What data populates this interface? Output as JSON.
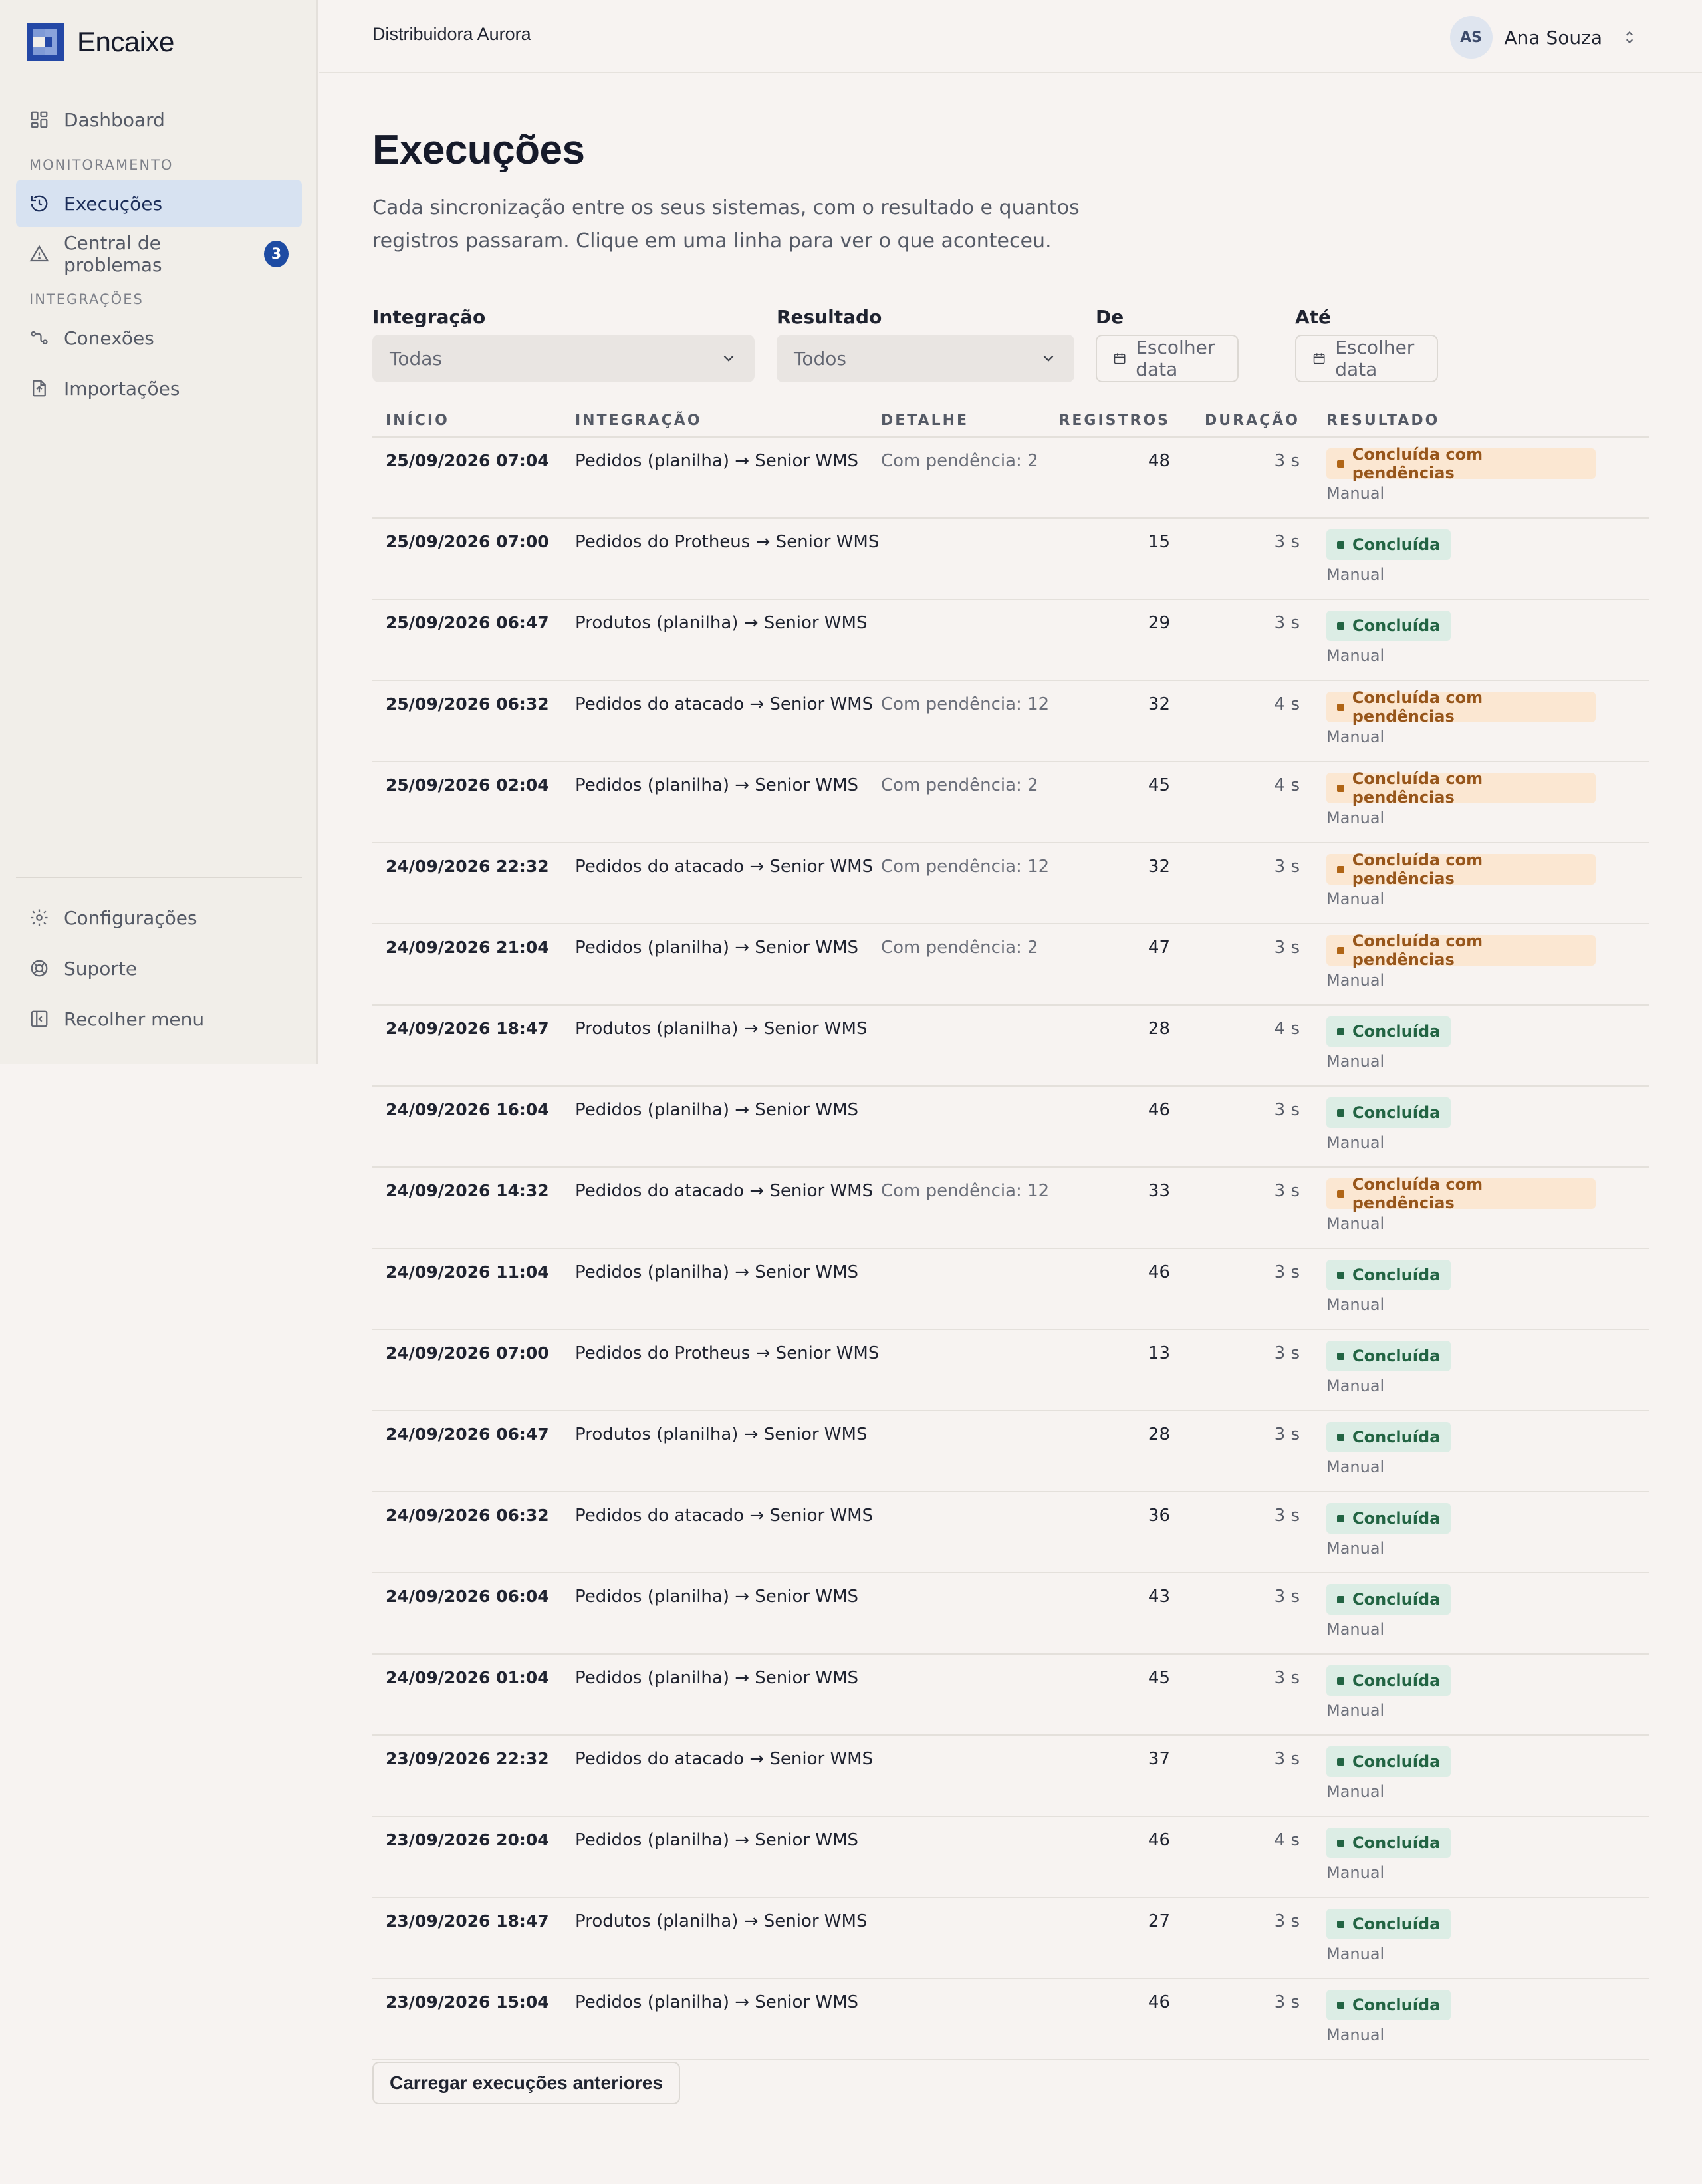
{
  "app": {
    "name": "Encaixe",
    "brand_color": "#2448a6"
  },
  "sidebar": {
    "dashboard": "Dashboard",
    "section_monitoring": "MONITORAMENTO",
    "executions": "Execuções",
    "problems": "Central de problemas",
    "problems_count": "3",
    "section_integrations": "INTEGRAÇÕES",
    "connections": "Conexões",
    "imports": "Importações",
    "settings": "Configurações",
    "support": "Suporte",
    "collapse": "Recolher menu"
  },
  "header": {
    "org": "Distribuidora Aurora",
    "user_initials": "AS",
    "user_name": "Ana Souza"
  },
  "page": {
    "title": "Execuções",
    "description": "Cada sincronização entre os seus sistemas, com o resultado e quantos registros passaram. Clique em uma linha para ver o que aconteceu."
  },
  "filters": {
    "integration_label": "Integração",
    "integration_value": "Todas",
    "result_label": "Resultado",
    "result_value": "Todos",
    "from_label": "De",
    "from_value": "Escolher data",
    "to_label": "Até",
    "to_value": "Escolher data"
  },
  "table": {
    "headers": [
      "INÍCIO",
      "INTEGRAÇÃO",
      "DETALHE",
      "REGISTROS",
      "DURAÇÃO",
      "RESULTADO"
    ],
    "rows": [
      {
        "start": "25/09/2026 07:04",
        "integration": "Pedidos (planilha) → Senior WMS",
        "detail": "Com pendência: 2",
        "records": "48",
        "duration": "3 s",
        "status": "Concluída com pendências",
        "kind": "warn",
        "trigger": "Manual"
      },
      {
        "start": "25/09/2026 07:00",
        "integration": "Pedidos do Protheus → Senior WMS",
        "detail": "",
        "records": "15",
        "duration": "3 s",
        "status": "Concluída",
        "kind": "ok",
        "trigger": "Manual"
      },
      {
        "start": "25/09/2026 06:47",
        "integration": "Produtos (planilha) → Senior WMS",
        "detail": "",
        "records": "29",
        "duration": "3 s",
        "status": "Concluída",
        "kind": "ok",
        "trigger": "Manual"
      },
      {
        "start": "25/09/2026 06:32",
        "integration": "Pedidos do atacado → Senior WMS",
        "detail": "Com pendência: 12",
        "records": "32",
        "duration": "4 s",
        "status": "Concluída com pendências",
        "kind": "warn",
        "trigger": "Manual"
      },
      {
        "start": "25/09/2026 02:04",
        "integration": "Pedidos (planilha) → Senior WMS",
        "detail": "Com pendência: 2",
        "records": "45",
        "duration": "4 s",
        "status": "Concluída com pendências",
        "kind": "warn",
        "trigger": "Manual"
      },
      {
        "start": "24/09/2026 22:32",
        "integration": "Pedidos do atacado → Senior WMS",
        "detail": "Com pendência: 12",
        "records": "32",
        "duration": "3 s",
        "status": "Concluída com pendências",
        "kind": "warn",
        "trigger": "Manual"
      },
      {
        "start": "24/09/2026 21:04",
        "integration": "Pedidos (planilha) → Senior WMS",
        "detail": "Com pendência: 2",
        "records": "47",
        "duration": "3 s",
        "status": "Concluída com pendências",
        "kind": "warn",
        "trigger": "Manual"
      },
      {
        "start": "24/09/2026 18:47",
        "integration": "Produtos (planilha) → Senior WMS",
        "detail": "",
        "records": "28",
        "duration": "4 s",
        "status": "Concluída",
        "kind": "ok",
        "trigger": "Manual"
      },
      {
        "start": "24/09/2026 16:04",
        "integration": "Pedidos (planilha) → Senior WMS",
        "detail": "",
        "records": "46",
        "duration": "3 s",
        "status": "Concluída",
        "kind": "ok",
        "trigger": "Manual"
      },
      {
        "start": "24/09/2026 14:32",
        "integration": "Pedidos do atacado → Senior WMS",
        "detail": "Com pendência: 12",
        "records": "33",
        "duration": "3 s",
        "status": "Concluída com pendências",
        "kind": "warn",
        "trigger": "Manual"
      },
      {
        "start": "24/09/2026 11:04",
        "integration": "Pedidos (planilha) → Senior WMS",
        "detail": "",
        "records": "46",
        "duration": "3 s",
        "status": "Concluída",
        "kind": "ok",
        "trigger": "Manual"
      },
      {
        "start": "24/09/2026 07:00",
        "integration": "Pedidos do Protheus → Senior WMS",
        "detail": "",
        "records": "13",
        "duration": "3 s",
        "status": "Concluída",
        "kind": "ok",
        "trigger": "Manual"
      },
      {
        "start": "24/09/2026 06:47",
        "integration": "Produtos (planilha) → Senior WMS",
        "detail": "",
        "records": "28",
        "duration": "3 s",
        "status": "Concluída",
        "kind": "ok",
        "trigger": "Manual"
      },
      {
        "start": "24/09/2026 06:32",
        "integration": "Pedidos do atacado → Senior WMS",
        "detail": "",
        "records": "36",
        "duration": "3 s",
        "status": "Concluída",
        "kind": "ok",
        "trigger": "Manual"
      },
      {
        "start": "24/09/2026 06:04",
        "integration": "Pedidos (planilha) → Senior WMS",
        "detail": "",
        "records": "43",
        "duration": "3 s",
        "status": "Concluída",
        "kind": "ok",
        "trigger": "Manual"
      },
      {
        "start": "24/09/2026 01:04",
        "integration": "Pedidos (planilha) → Senior WMS",
        "detail": "",
        "records": "45",
        "duration": "3 s",
        "status": "Concluída",
        "kind": "ok",
        "trigger": "Manual"
      },
      {
        "start": "23/09/2026 22:32",
        "integration": "Pedidos do atacado → Senior WMS",
        "detail": "",
        "records": "37",
        "duration": "3 s",
        "status": "Concluída",
        "kind": "ok",
        "trigger": "Manual"
      },
      {
        "start": "23/09/2026 20:04",
        "integration": "Pedidos (planilha) → Senior WMS",
        "detail": "",
        "records": "46",
        "duration": "4 s",
        "status": "Concluída",
        "kind": "ok",
        "trigger": "Manual"
      },
      {
        "start": "23/09/2026 18:47",
        "integration": "Produtos (planilha) → Senior WMS",
        "detail": "",
        "records": "27",
        "duration": "3 s",
        "status": "Concluída",
        "kind": "ok",
        "trigger": "Manual"
      },
      {
        "start": "23/09/2026 15:04",
        "integration": "Pedidos (planilha) → Senior WMS",
        "detail": "",
        "records": "46",
        "duration": "3 s",
        "status": "Concluída",
        "kind": "ok",
        "trigger": "Manual"
      }
    ]
  },
  "load_more": "Carregar execuções anteriores"
}
